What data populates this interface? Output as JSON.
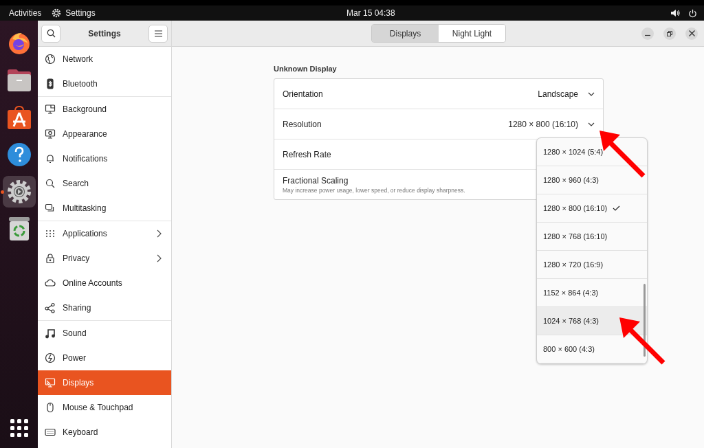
{
  "top_bar": {
    "activities": "Activities",
    "app_name": "Settings",
    "clock": "Mar 15  04:38"
  },
  "dock": [
    {
      "kind": "firefox",
      "active": false
    },
    {
      "kind": "files",
      "active": false
    },
    {
      "kind": "store",
      "active": false
    },
    {
      "kind": "help",
      "active": false
    },
    {
      "kind": "settings",
      "active": true
    },
    {
      "kind": "trash",
      "active": false
    }
  ],
  "sidebar": {
    "title": "Settings",
    "groups": [
      [
        {
          "label": "Network",
          "kind": "globe",
          "selected": false,
          "submenu": false
        },
        {
          "label": "Bluetooth",
          "kind": "bluetooth",
          "selected": false,
          "submenu": false
        }
      ],
      [
        {
          "label": "Background",
          "kind": "monitor",
          "selected": false,
          "submenu": false
        },
        {
          "label": "Appearance",
          "kind": "appearance",
          "selected": false,
          "submenu": false
        },
        {
          "label": "Notifications",
          "kind": "bell",
          "selected": false,
          "submenu": false
        },
        {
          "label": "Search",
          "kind": "search",
          "selected": false,
          "submenu": false
        },
        {
          "label": "Multitasking",
          "kind": "multitask",
          "selected": false,
          "submenu": false
        }
      ],
      [
        {
          "label": "Applications",
          "kind": "grid",
          "selected": false,
          "submenu": true
        },
        {
          "label": "Privacy",
          "kind": "lock",
          "selected": false,
          "submenu": true
        },
        {
          "label": "Online Accounts",
          "kind": "cloud",
          "selected": false,
          "submenu": false
        },
        {
          "label": "Sharing",
          "kind": "share",
          "selected": false,
          "submenu": false
        }
      ],
      [
        {
          "label": "Sound",
          "kind": "music",
          "selected": false,
          "submenu": false
        },
        {
          "label": "Power",
          "kind": "power",
          "selected": false,
          "submenu": false
        },
        {
          "label": "Displays",
          "kind": "display",
          "selected": true,
          "submenu": false
        },
        {
          "label": "Mouse & Touchpad",
          "kind": "mouse",
          "selected": false,
          "submenu": false
        },
        {
          "label": "Keyboard",
          "kind": "keyboard",
          "selected": false,
          "submenu": false
        }
      ]
    ]
  },
  "tabs": [
    {
      "label": "Displays",
      "selected": true
    },
    {
      "label": "Night Light",
      "selected": false
    }
  ],
  "display": {
    "title": "Unknown Display",
    "rows": [
      {
        "kind": "select",
        "label": "Orientation",
        "value": "Landscape"
      },
      {
        "kind": "select",
        "label": "Resolution",
        "value": "1280 × 800 (16:10)"
      },
      {
        "kind": "plain",
        "label": "Refresh Rate"
      },
      {
        "kind": "plain",
        "label": "Fractional Scaling",
        "description": "May increase power usage, lower speed, or reduce display sharpness."
      }
    ]
  },
  "resolution_menu": [
    {
      "label": "1280 × 1024 (5:4)",
      "selected": false,
      "highlighted": false
    },
    {
      "label": "1280 × 960 (4:3)",
      "selected": false,
      "highlighted": false
    },
    {
      "label": "1280 × 800 (16:10)",
      "selected": true,
      "highlighted": false
    },
    {
      "label": "1280 × 768 (16:10)",
      "selected": false,
      "highlighted": false
    },
    {
      "label": "1280 × 720 (16:9)",
      "selected": false,
      "highlighted": false
    },
    {
      "label": "1152 × 864 (4:3)",
      "selected": false,
      "highlighted": false
    },
    {
      "label": "1024 × 768 (4:3)",
      "selected": false,
      "highlighted": true
    },
    {
      "label": "800 × 600 (4:3)",
      "selected": false,
      "highlighted": false
    }
  ]
}
